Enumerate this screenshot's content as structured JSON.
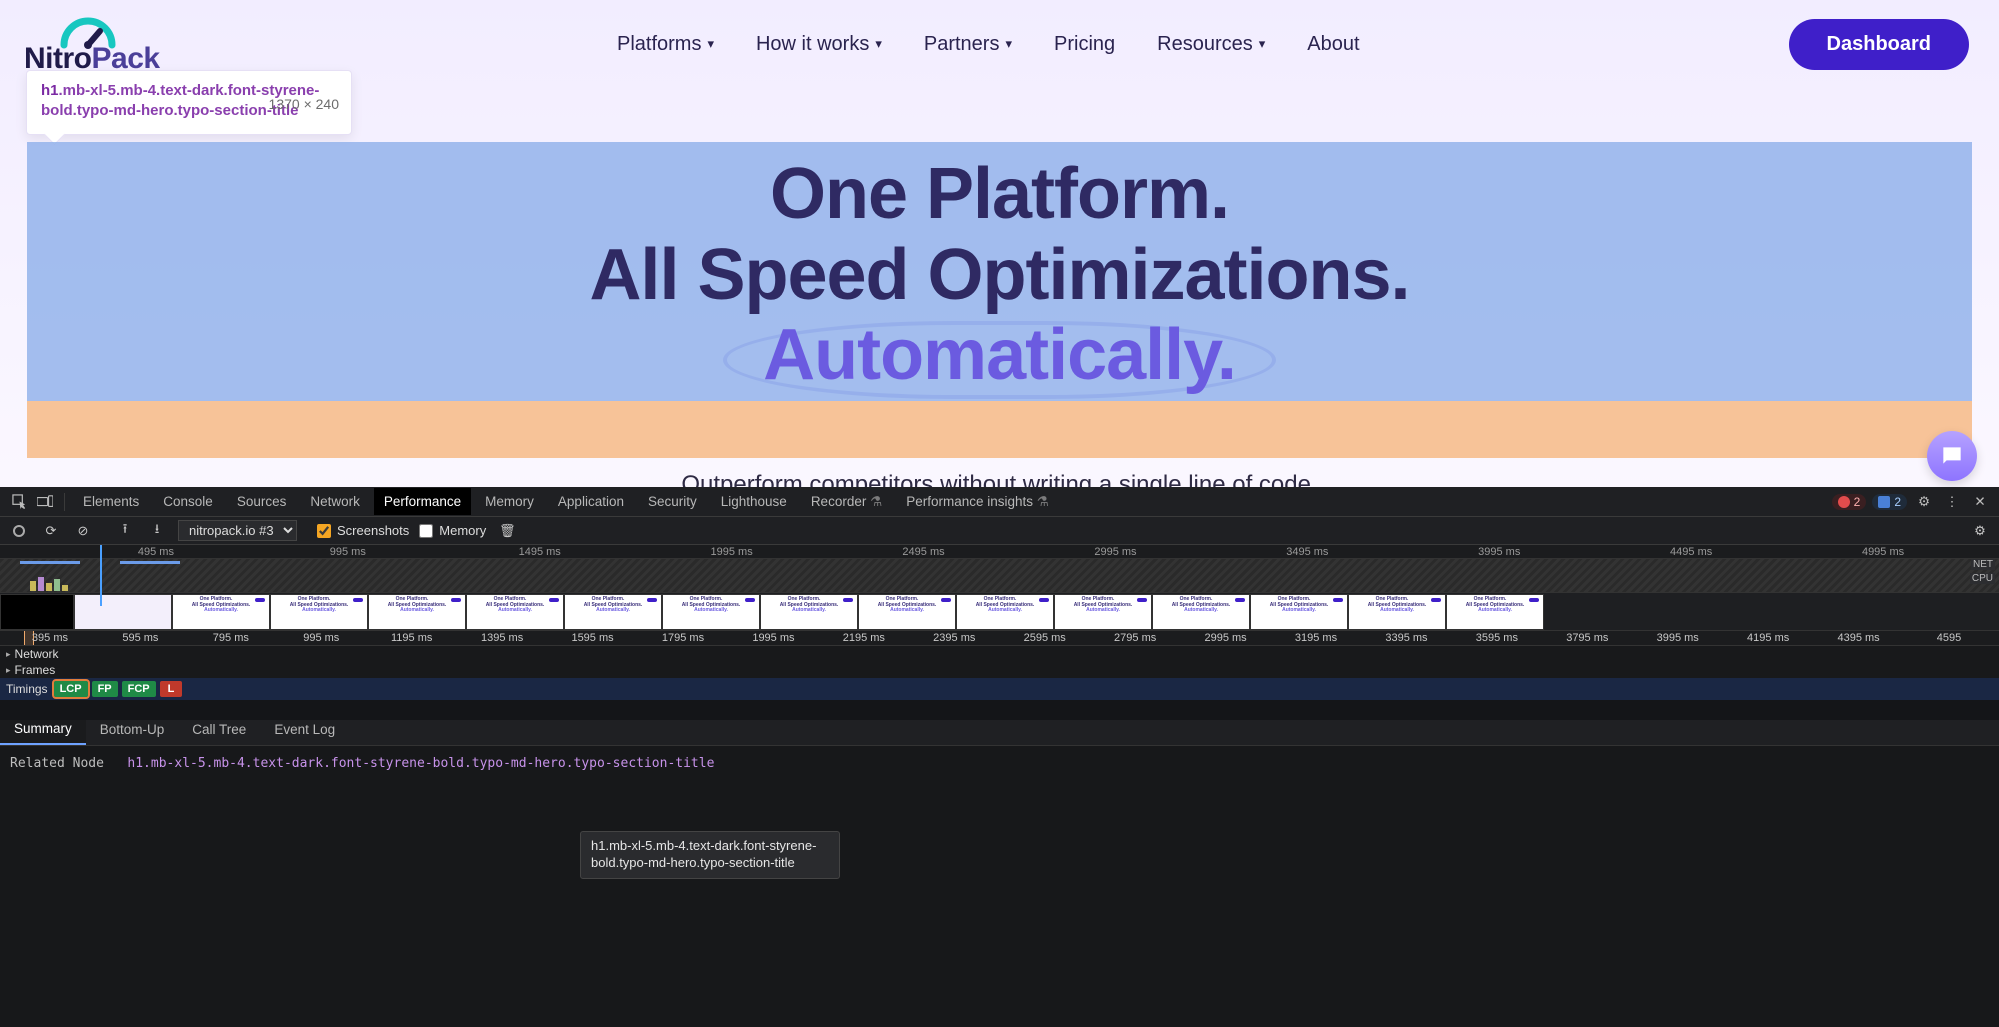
{
  "site": {
    "logo": {
      "brand1": "Nitro",
      "brand2": "Pack"
    },
    "nav": {
      "platforms": "Platforms",
      "how": "How it works",
      "partners": "Partners",
      "pricing": "Pricing",
      "resources": "Resources",
      "about": "About"
    },
    "cta": "Dashboard",
    "tooltip": {
      "tag": "h1",
      "selector": ".mb-xl-5.mb-4.text-dark.font-styrene-bold.typo-md-hero.typo-section-title",
      "dimensions": "1370 × 240"
    },
    "hero": {
      "line1": "One Platform.",
      "line2": "All Speed Optimizations.",
      "line3": "Automatically."
    },
    "tagline": "Outperform competitors without writing a single line of code."
  },
  "devtools": {
    "tabs": {
      "elements": "Elements",
      "console": "Console",
      "sources": "Sources",
      "network": "Network",
      "performance": "Performance",
      "memory": "Memory",
      "application": "Application",
      "security": "Security",
      "lighthouse": "Lighthouse",
      "recorder": "Recorder",
      "insights": "Performance insights"
    },
    "errors": "2",
    "messages": "2",
    "toolbar": {
      "profileName": "nitropack.io #3",
      "screenshotsLabel": "Screenshots",
      "screenshotsChecked": true,
      "memoryLabel": "Memory",
      "memoryChecked": false
    },
    "ruler1": [
      "495 ms",
      "995 ms",
      "1495 ms",
      "1995 ms",
      "2495 ms",
      "2995 ms",
      "3495 ms",
      "3995 ms",
      "4495 ms",
      "4995 ms"
    ],
    "ruler2": [
      "395 ms",
      "595 ms",
      "795 ms",
      "995 ms",
      "1195 ms",
      "1395 ms",
      "1595 ms",
      "1795 ms",
      "1995 ms",
      "2195 ms",
      "2395 ms",
      "2595 ms",
      "2795 ms",
      "2995 ms",
      "3195 ms",
      "3395 ms",
      "3595 ms",
      "3795 ms",
      "3995 ms",
      "4195 ms",
      "4395 ms",
      "4595"
    ],
    "overviewLanes": {
      "cpu": "CPU",
      "net": "NET"
    },
    "thumbLines": {
      "l1": "One Platform.",
      "l2": "All Speed Optimizations.",
      "l3": "Automatically."
    },
    "tracks": {
      "network": "Network",
      "frames": "Frames",
      "timings": "Timings"
    },
    "timingBadges": {
      "lcp": "LCP",
      "fp": "FP",
      "fcp": "FCP",
      "l": "L"
    },
    "hoverTip": "h1.mb-xl-5.mb-4.text-dark.font-styrene-bold.typo-md-hero.typo-section-title",
    "bottomTabs": {
      "summary": "Summary",
      "bottomup": "Bottom-Up",
      "calltree": "Call Tree",
      "eventlog": "Event Log"
    },
    "related": {
      "label": "Related Node",
      "node": "h1.mb-xl-5.mb-4.text-dark.font-styrene-bold.typo-md-hero.typo-section-title"
    }
  }
}
